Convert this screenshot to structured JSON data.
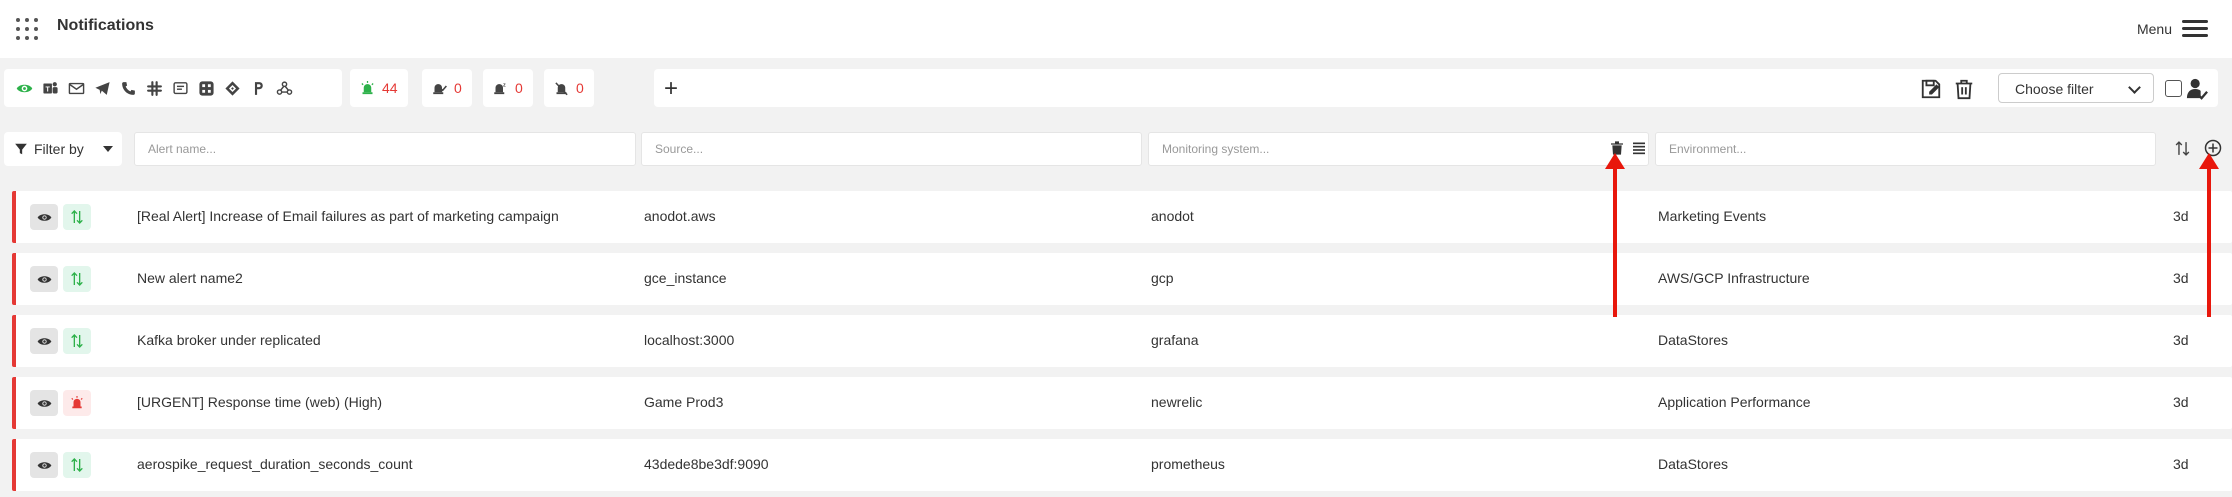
{
  "header": {
    "title": "Notifications",
    "menu_label": "Menu"
  },
  "toolbar": {
    "channels": [
      "eye-icon",
      "teams-icon",
      "email-icon",
      "telegram-icon",
      "phone-icon",
      "slack-icon",
      "sms-icon",
      "grid-icon",
      "jira-icon",
      "pagerduty-icon",
      "webhook-icon"
    ],
    "counters": [
      {
        "name": "active-alerts",
        "value": "44",
        "color": "#2db14a"
      },
      {
        "name": "acknowledged-alerts",
        "value": "0"
      },
      {
        "name": "snoozed-alerts",
        "value": "0"
      },
      {
        "name": "muted-alerts",
        "value": "0"
      }
    ],
    "add": "+",
    "filter_select": "Choose filter"
  },
  "filters": {
    "filter_by": "Filter by",
    "alert_placeholder": "Alert name...",
    "source_placeholder": "Source...",
    "monitoring_placeholder": "Monitoring system...",
    "environment_placeholder": "Environment..."
  },
  "alerts": [
    {
      "name": "[Real Alert] Increase of Email failures as part of marketing campaign",
      "source": "anodot.aws",
      "monitoring": "anodot",
      "environment": "Marketing Events",
      "age": "3d",
      "status": "updown"
    },
    {
      "name": "New alert name2",
      "source": "gce_instance",
      "monitoring": "gcp",
      "environment": "AWS/GCP Infrastructure",
      "age": "3d",
      "status": "updown"
    },
    {
      "name": "Kafka broker under replicated",
      "source": "localhost:3000",
      "monitoring": "grafana",
      "environment": "DataStores",
      "age": "3d",
      "status": "updown"
    },
    {
      "name": "[URGENT] Response time (web) (High)",
      "source": "Game Prod3",
      "monitoring": "newrelic",
      "environment": "Application Performance",
      "age": "3d",
      "status": "alarm"
    },
    {
      "name": "aerospike_request_duration_seconds_count",
      "source": "43dede8be3df:9090",
      "monitoring": "prometheus",
      "environment": "DataStores",
      "age": "3d",
      "status": "updown"
    }
  ],
  "colors": {
    "accent_red": "#e53935",
    "annotation_red": "#e8170c",
    "active_green": "#2db14a"
  }
}
